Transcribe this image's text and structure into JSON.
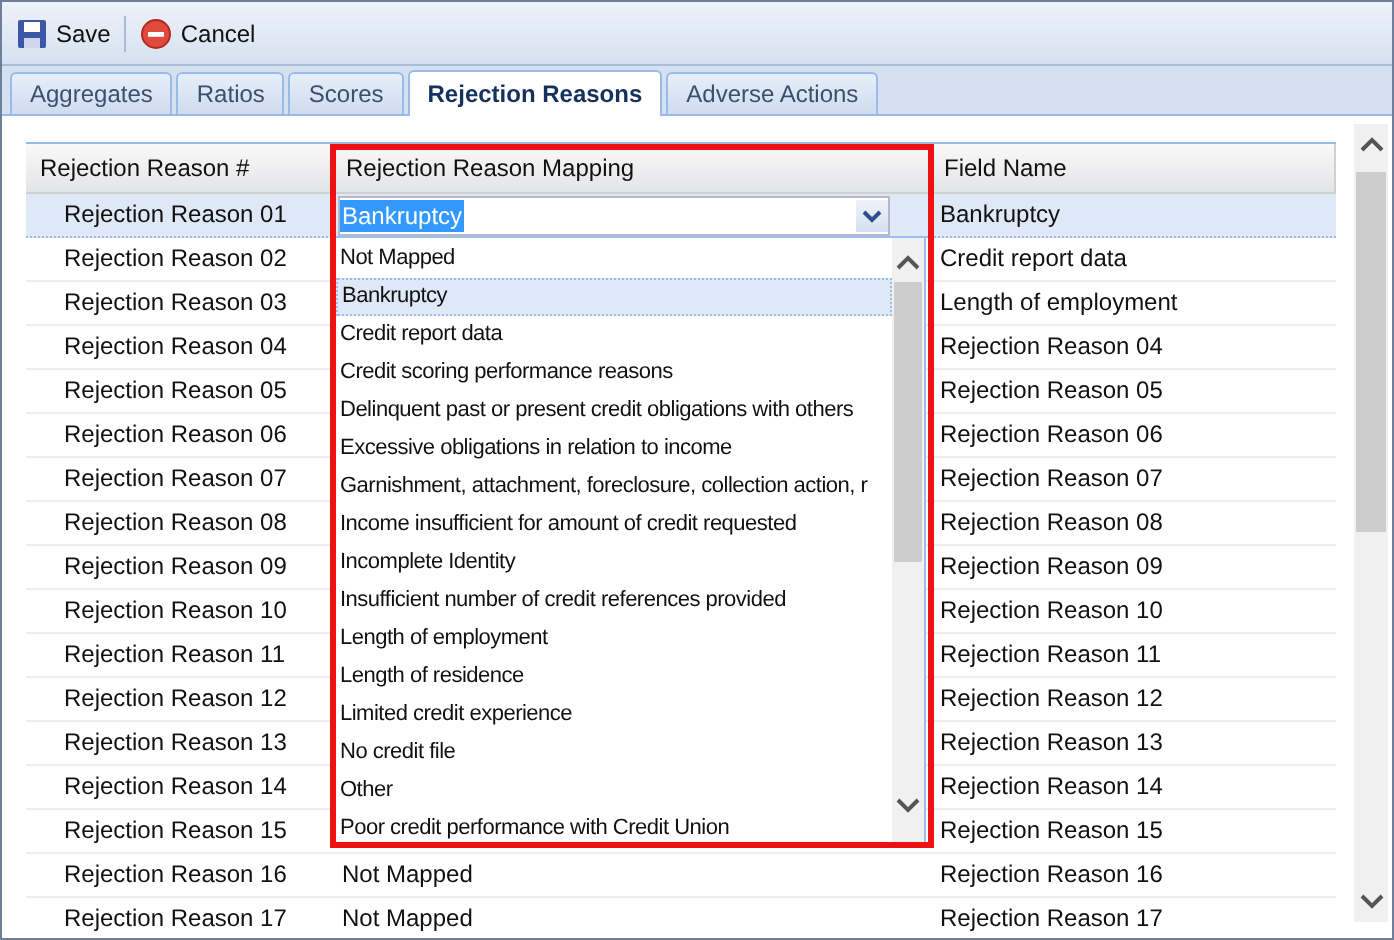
{
  "toolbar": {
    "buttons": [
      {
        "kind": "save",
        "label": "Save"
      },
      {
        "kind": "cancel",
        "label": "Cancel"
      }
    ]
  },
  "tabs": [
    {
      "label": "Aggregates",
      "selected": false
    },
    {
      "label": "Ratios",
      "selected": false
    },
    {
      "label": "Scores",
      "selected": false
    },
    {
      "label": "Rejection Reasons",
      "selected": true
    },
    {
      "label": "Adverse Actions",
      "selected": false
    }
  ],
  "table": {
    "columns": [
      "Rejection Reason #",
      "Rejection Reason Mapping",
      "Field Name"
    ],
    "rows": [
      {
        "number": "Rejection Reason 01",
        "mapping": "Bankruptcy",
        "field": "Bankruptcy",
        "selected": true
      },
      {
        "number": "Rejection Reason 02",
        "field": "Credit report data",
        "selected": false
      },
      {
        "number": "Rejection Reason 03",
        "field": "Length of employment",
        "selected": false
      },
      {
        "number": "Rejection Reason 04",
        "field": "Rejection Reason 04",
        "selected": false
      },
      {
        "number": "Rejection Reason 05",
        "field": "Rejection Reason 05",
        "selected": false
      },
      {
        "number": "Rejection Reason 06",
        "field": "Rejection Reason 06",
        "selected": false
      },
      {
        "number": "Rejection Reason 07",
        "field": "Rejection Reason 07",
        "selected": false
      },
      {
        "number": "Rejection Reason 08",
        "field": "Rejection Reason 08",
        "selected": false
      },
      {
        "number": "Rejection Reason 09",
        "field": "Rejection Reason 09",
        "selected": false
      },
      {
        "number": "Rejection Reason 10",
        "field": "Rejection Reason 10",
        "selected": false
      },
      {
        "number": "Rejection Reason 11",
        "field": "Rejection Reason 11",
        "selected": false
      },
      {
        "number": "Rejection Reason 12",
        "field": "Rejection Reason 12",
        "selected": false
      },
      {
        "number": "Rejection Reason 13",
        "field": "Rejection Reason 13",
        "selected": false
      },
      {
        "number": "Rejection Reason 14",
        "field": "Rejection Reason 14",
        "selected": false
      },
      {
        "number": "Rejection Reason 15",
        "field": "Rejection Reason 15",
        "selected": false
      },
      {
        "number": "Rejection Reason 16",
        "mapping": "Not Mapped",
        "field": "Rejection Reason 16",
        "selected": false
      },
      {
        "number": "Rejection Reason 17",
        "mapping": "Not Mapped",
        "field": "Rejection Reason 17",
        "selected": false
      }
    ]
  },
  "dropdown": {
    "options": [
      {
        "label": "Not Mapped",
        "selected": false
      },
      {
        "label": "Bankruptcy",
        "selected": true
      },
      {
        "label": "Credit report data",
        "selected": false
      },
      {
        "label": "Credit scoring performance reasons",
        "selected": false
      },
      {
        "label": "Delinquent past or present credit obligations with others",
        "selected": false
      },
      {
        "label": "Excessive obligations in relation to income",
        "selected": false
      },
      {
        "label": "Garnishment, attachment, foreclosure, collection action, r",
        "selected": false
      },
      {
        "label": "Income insufficient for amount of credit requested",
        "selected": false
      },
      {
        "label": "Incomplete Identity",
        "selected": false
      },
      {
        "label": "Insufficient number of credit references provided",
        "selected": false
      },
      {
        "label": "Length of employment",
        "selected": false
      },
      {
        "label": "Length of residence",
        "selected": false
      },
      {
        "label": "Limited credit experience",
        "selected": false
      },
      {
        "label": "No credit file",
        "selected": false
      },
      {
        "label": "Other",
        "selected": false
      },
      {
        "label": "Poor credit performance with Credit Union",
        "selected": false
      }
    ]
  }
}
